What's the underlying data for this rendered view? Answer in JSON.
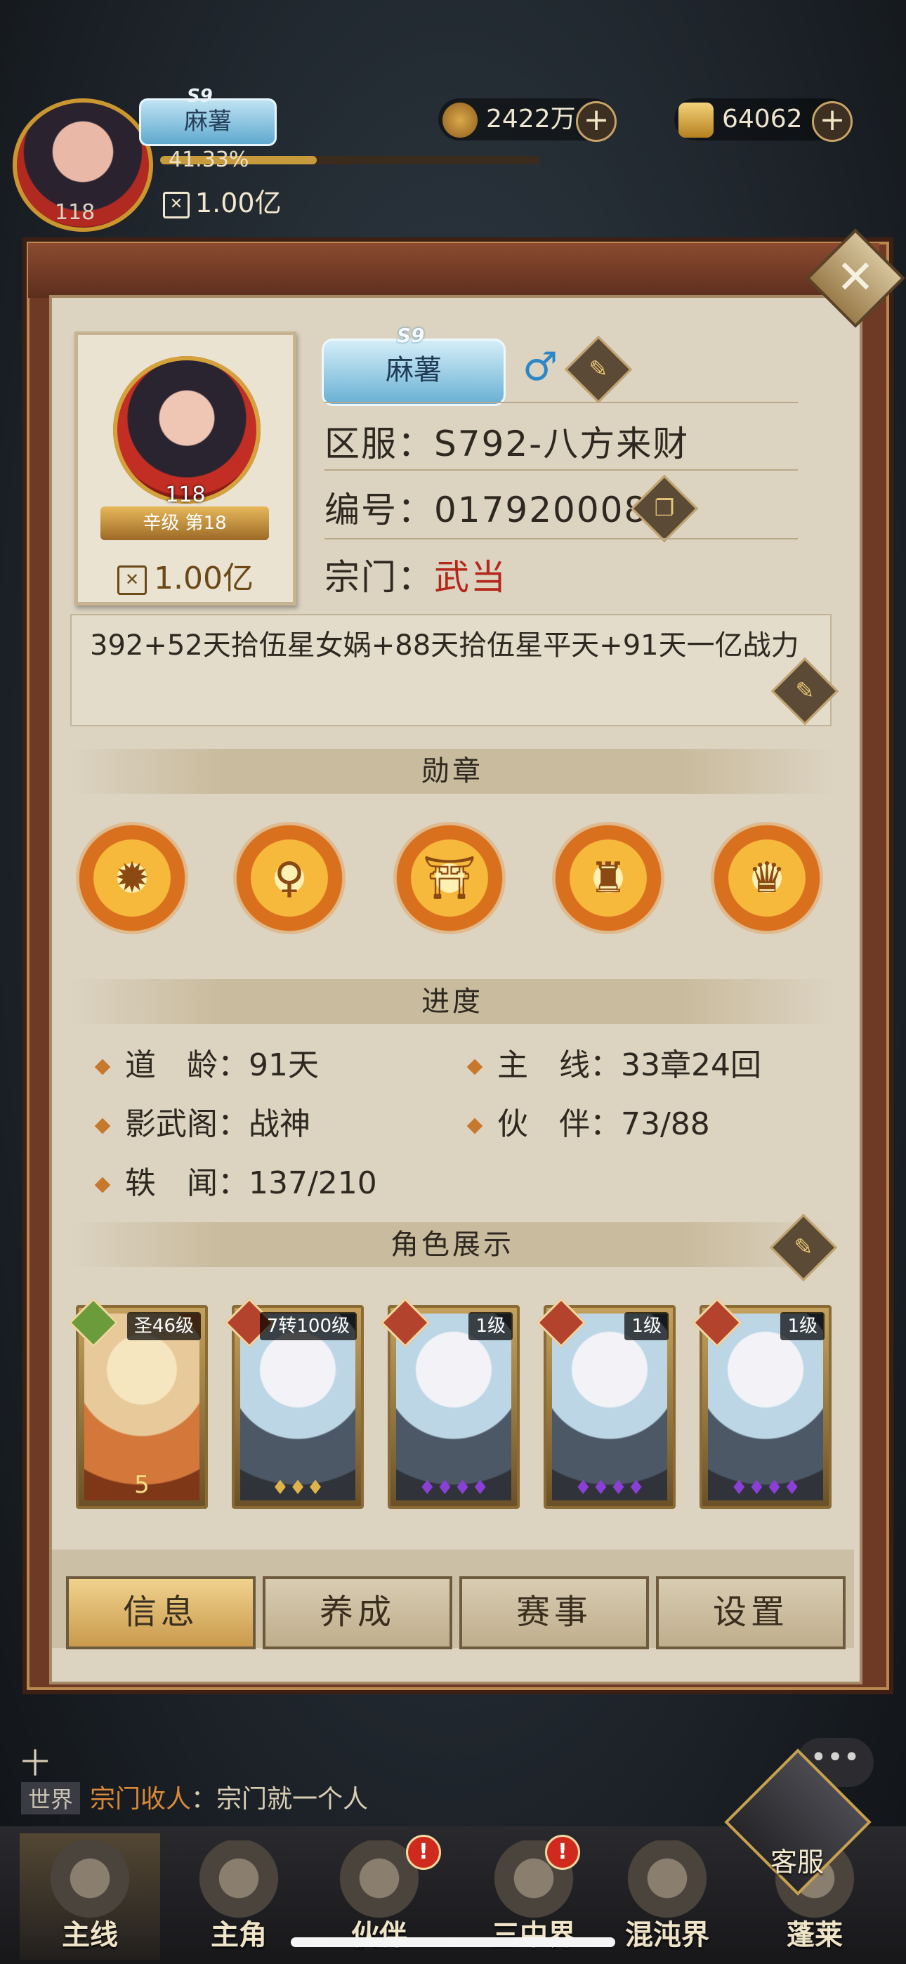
{
  "hud": {
    "server_tag": "S9",
    "name": "麻薯",
    "exp_percent": "41.33%",
    "exp_fraction": 0.4133,
    "level": "118",
    "power": "1.00亿",
    "copper": "2422万",
    "gold": "64062",
    "plus": "+"
  },
  "close_label": "✕",
  "profile": {
    "server_tag": "S9",
    "name": "麻薯",
    "gender_symbol": "♂",
    "level": "118",
    "rank_text": "辛级 第18",
    "power": "1.00亿",
    "server_line": "区服：S792-八方来财",
    "id_line": "编号：017920008",
    "sect_label": "宗门：",
    "sect_value": "武当",
    "signature": "392+52天拾伍星女娲+88天拾伍星平天+91天一亿战力"
  },
  "sections": {
    "medals": "勋章",
    "progress": "进度",
    "showcase": "角色展示"
  },
  "medals": [
    {
      "icon": "flame-beast-icon"
    },
    {
      "icon": "maiden-icon"
    },
    {
      "icon": "temple-icon"
    },
    {
      "icon": "pagoda-icon"
    },
    {
      "icon": "deity-icon"
    }
  ],
  "progress": {
    "dao_age": "道　龄：91天",
    "main_line": "主　线：33章24回",
    "shadow_pavilion": "影武阁：战神",
    "partners": "伙　伴：73/88",
    "anecdotes": "轶　闻：137/210"
  },
  "cards": [
    {
      "tag": "圣46级",
      "stars": "5"
    },
    {
      "tag": "7转100级",
      "stars": "♦♦♦"
    },
    {
      "tag": "1级",
      "stars": "♦♦♦♦"
    },
    {
      "tag": "1级",
      "stars": "♦♦♦♦"
    },
    {
      "tag": "1级",
      "stars": "♦♦♦♦"
    }
  ],
  "tabs": [
    "信息",
    "养成",
    "赛事",
    "设置"
  ],
  "active_tab": "信息",
  "chat": {
    "partial_line": "十",
    "channel": "世界",
    "speaker": "宗门收人",
    "message": "：宗门就一个人",
    "bubble": "•••"
  },
  "customer_service": "客服",
  "nav": [
    {
      "label": "主线"
    },
    {
      "label": "主角"
    },
    {
      "label": "伙伴"
    },
    {
      "label": "三中界"
    },
    {
      "label": "混沌界"
    },
    {
      "label": "蓬莱"
    }
  ],
  "alert_badge": "!",
  "colors": {
    "sect_red": "#b4281c",
    "panel_bg": "#dcd3c1",
    "accent_gold": "#c79a3b"
  }
}
